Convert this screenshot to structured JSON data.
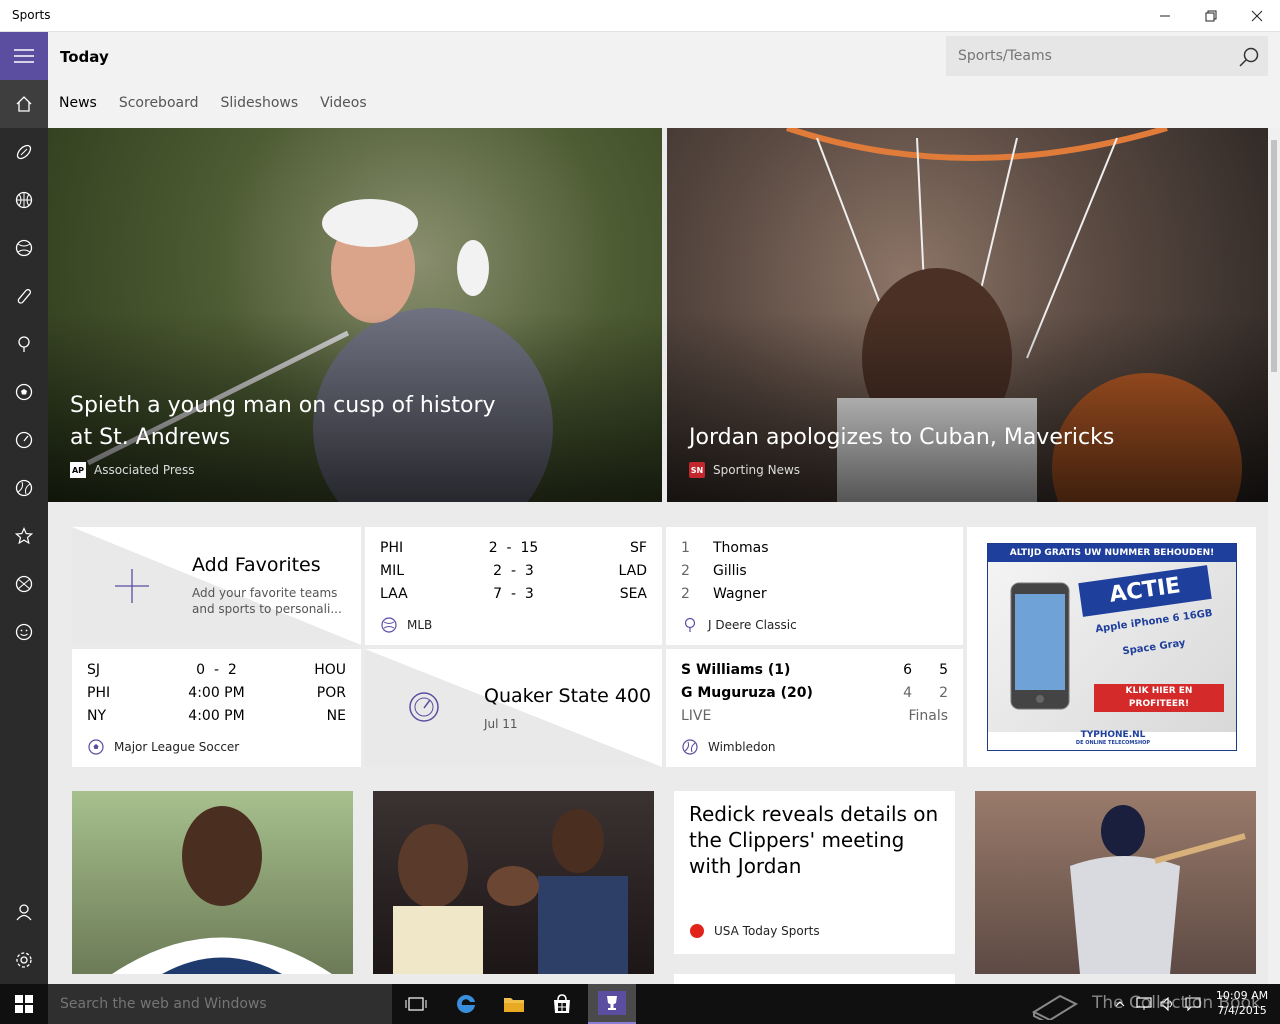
{
  "window": {
    "title": "Sports"
  },
  "header": {
    "page_title": "Today",
    "search_placeholder": "Sports/Teams",
    "tabs": [
      {
        "label": "News",
        "active": true
      },
      {
        "label": "Scoreboard",
        "active": false
      },
      {
        "label": "Slideshows",
        "active": false
      },
      {
        "label": "Videos",
        "active": false
      }
    ]
  },
  "nav_icons": [
    "home-icon",
    "football-icon",
    "basketball-icon",
    "baseball-icon",
    "hockey-icon",
    "golf-icon",
    "soccer-icon",
    "racing-icon",
    "tennis-icon",
    "favorites-icon",
    "more-sports-icon",
    "fantasy-icon",
    "account-icon",
    "settings-icon"
  ],
  "hero": [
    {
      "headline": "Spieth a young man on cusp of history at St. Andrews",
      "source": "Associated Press",
      "logo": "AP"
    },
    {
      "headline": "Jordan apologizes to Cuban, Mavericks",
      "source": "Sporting News",
      "logo": "SN"
    }
  ],
  "favorites": {
    "title": "Add Favorites",
    "desc": "Add your favorite teams and sports to personali..."
  },
  "mlb": {
    "rows": [
      {
        "home": "PHI",
        "score": "2  -  15",
        "away": "SF"
      },
      {
        "home": "MIL",
        "score": "2  -  3",
        "away": "LAD"
      },
      {
        "home": "LAA",
        "score": "7  -  3",
        "away": "SEA"
      }
    ],
    "league": "MLB"
  },
  "golf": {
    "rows": [
      {
        "pos": "1",
        "name": "Thomas"
      },
      {
        "pos": "2",
        "name": "Gillis"
      },
      {
        "pos": "2",
        "name": "Wagner"
      }
    ],
    "event": "J Deere Classic"
  },
  "mls": {
    "rows": [
      {
        "home": "SJ",
        "score": "0  -  2",
        "away": "HOU"
      },
      {
        "home": "PHI",
        "score": "4:00 PM",
        "away": "POR"
      },
      {
        "home": "NY",
        "score": "4:00 PM",
        "away": "NE"
      }
    ],
    "league": "Major League Soccer"
  },
  "racing": {
    "title": "Quaker State 400",
    "date": "Jul 11"
  },
  "tennis": {
    "p1": "S Williams (1)",
    "p1s1": "6",
    "p1s2": "5",
    "p2": "G Muguruza (20)",
    "p2s1": "4",
    "p2s2": "2",
    "status": "LIVE",
    "round": "Finals",
    "event": "Wimbledon"
  },
  "ad": {
    "banner": "ALTIJD GRATIS UW NUMMER BEHOUDEN!",
    "actie": "ACTIE",
    "product": "Apple iPhone 6 16GB",
    "color": "Space Gray",
    "cta": "KLIK HIER EN PROFITEER!",
    "brand": "TYPHONE.NL",
    "tagline": "DE ONLINE TELECOMSHOP"
  },
  "story": {
    "headline": "Redick reveals details on the Clippers' meeting with Jordan",
    "source": "USA Today Sports"
  },
  "taskbar": {
    "search_placeholder": "Search the web and Windows",
    "time": "10:09 AM",
    "date": "7/4/2015",
    "watermark": "The Collection Book"
  },
  "colors": {
    "accent": "#5b4ea1",
    "rail": "#2b2b2b",
    "taskbar": "#101010"
  }
}
